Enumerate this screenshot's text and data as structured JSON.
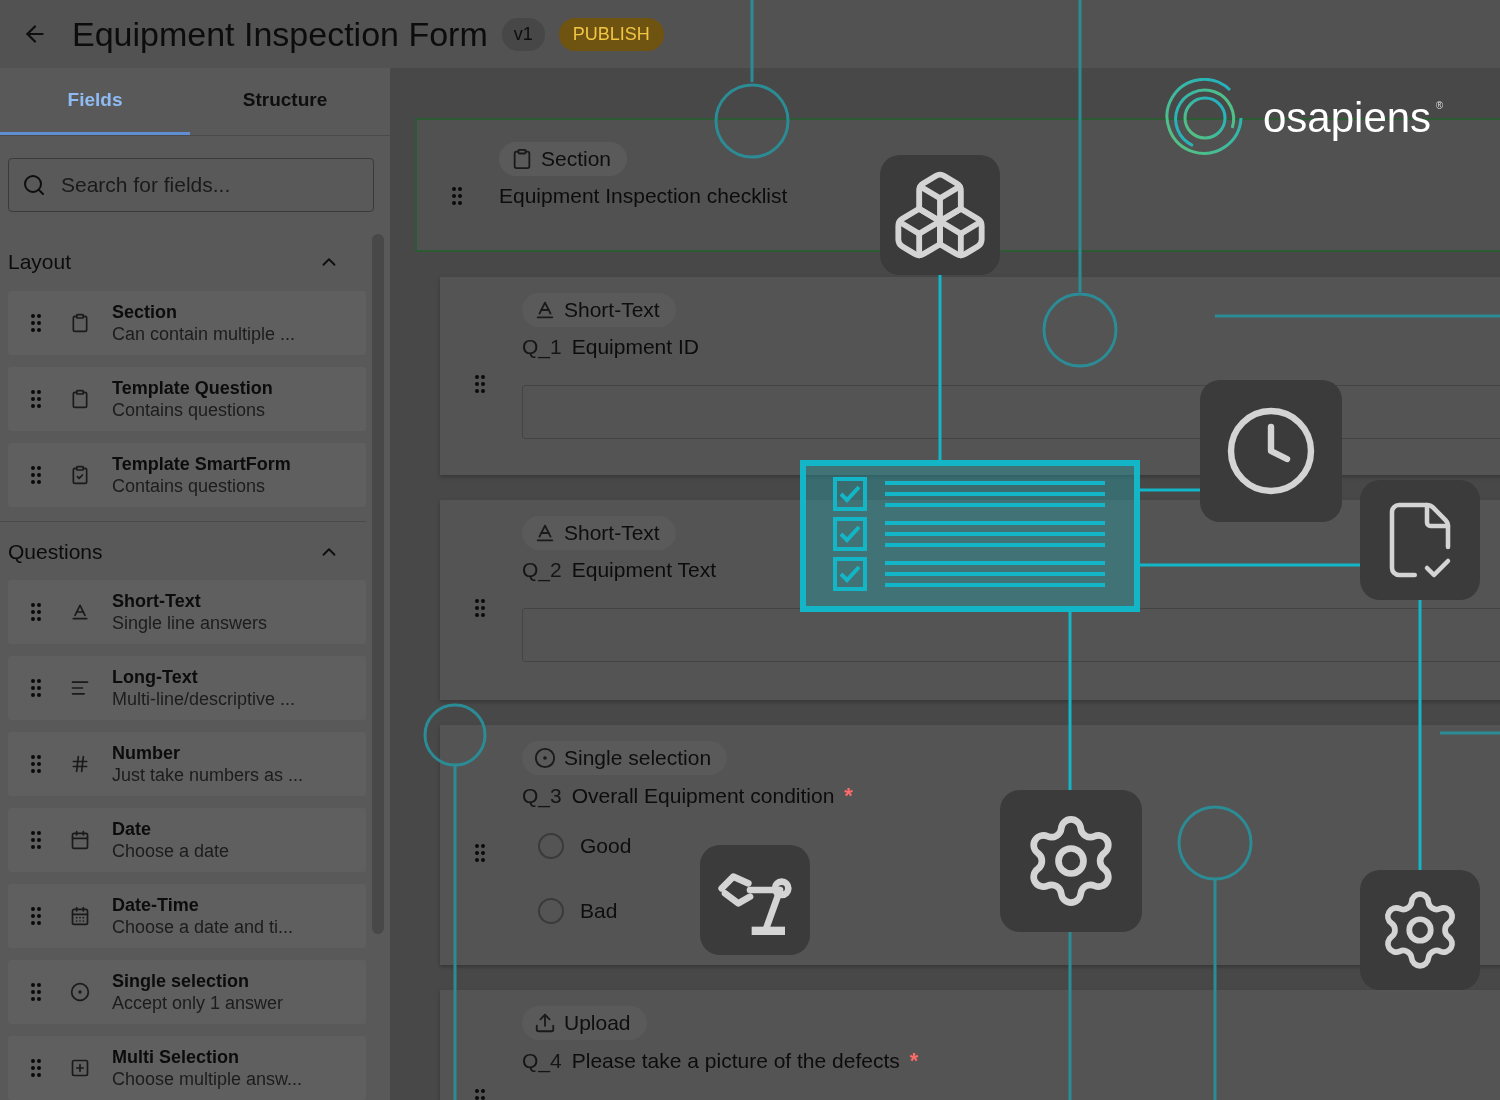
{
  "header": {
    "title": "Equipment Inspection Form",
    "version": "v1",
    "publish_label": "PUBLISH"
  },
  "sidebar": {
    "tabs": [
      {
        "label": "Fields",
        "selected": true
      },
      {
        "label": "Structure",
        "selected": false
      }
    ],
    "search": {
      "placeholder": "Search for fields..."
    },
    "groups": [
      {
        "title": "Layout",
        "expanded": true,
        "items": [
          {
            "kind": "section",
            "name": "Section",
            "description": "Can contain multiple ..."
          },
          {
            "kind": "template-question",
            "name": "Template Question",
            "description": "Contains questions"
          },
          {
            "kind": "template-form",
            "name": "Template SmartForm",
            "description": "Contains questions"
          }
        ]
      },
      {
        "title": "Questions",
        "expanded": true,
        "items": [
          {
            "kind": "short-text",
            "name": "Short-Text",
            "description": "Single line answers"
          },
          {
            "kind": "long-text",
            "name": "Long-Text",
            "description": "Multi-line/descriptive ..."
          },
          {
            "kind": "number",
            "name": "Number",
            "description": "Just take numbers as ..."
          },
          {
            "kind": "date",
            "name": "Date",
            "description": "Choose a date"
          },
          {
            "kind": "date-time",
            "name": "Date-Time",
            "description": "Choose a date and ti..."
          },
          {
            "kind": "single-selection",
            "name": "Single selection",
            "description": "Accept only 1 answer"
          },
          {
            "kind": "multi-selection",
            "name": "Multi Selection",
            "description": "Choose multiple answ..."
          }
        ]
      }
    ]
  },
  "canvas": {
    "section": {
      "chip": "Section",
      "title": "Equipment Inspection checklist"
    },
    "questions": [
      {
        "kind": "short-text",
        "chip": "Short-Text",
        "number": "Q_1",
        "label": "Equipment ID"
      },
      {
        "kind": "short-text",
        "chip": "Short-Text",
        "number": "Q_2",
        "label": "Equipment Text"
      },
      {
        "kind": "single-selection",
        "chip": "Single selection",
        "number": "Q_3",
        "label": "Overall Equipment condition",
        "required_mark": "*",
        "options": [
          {
            "label": "Good",
            "selected": false
          },
          {
            "label": "Bad",
            "selected": false
          }
        ]
      },
      {
        "kind": "upload",
        "chip": "Upload",
        "number": "Q_4",
        "label": "Please take a picture of the defects",
        "required_mark": "*"
      }
    ]
  },
  "logo": {
    "name": "osapiens",
    "mark": "®"
  }
}
